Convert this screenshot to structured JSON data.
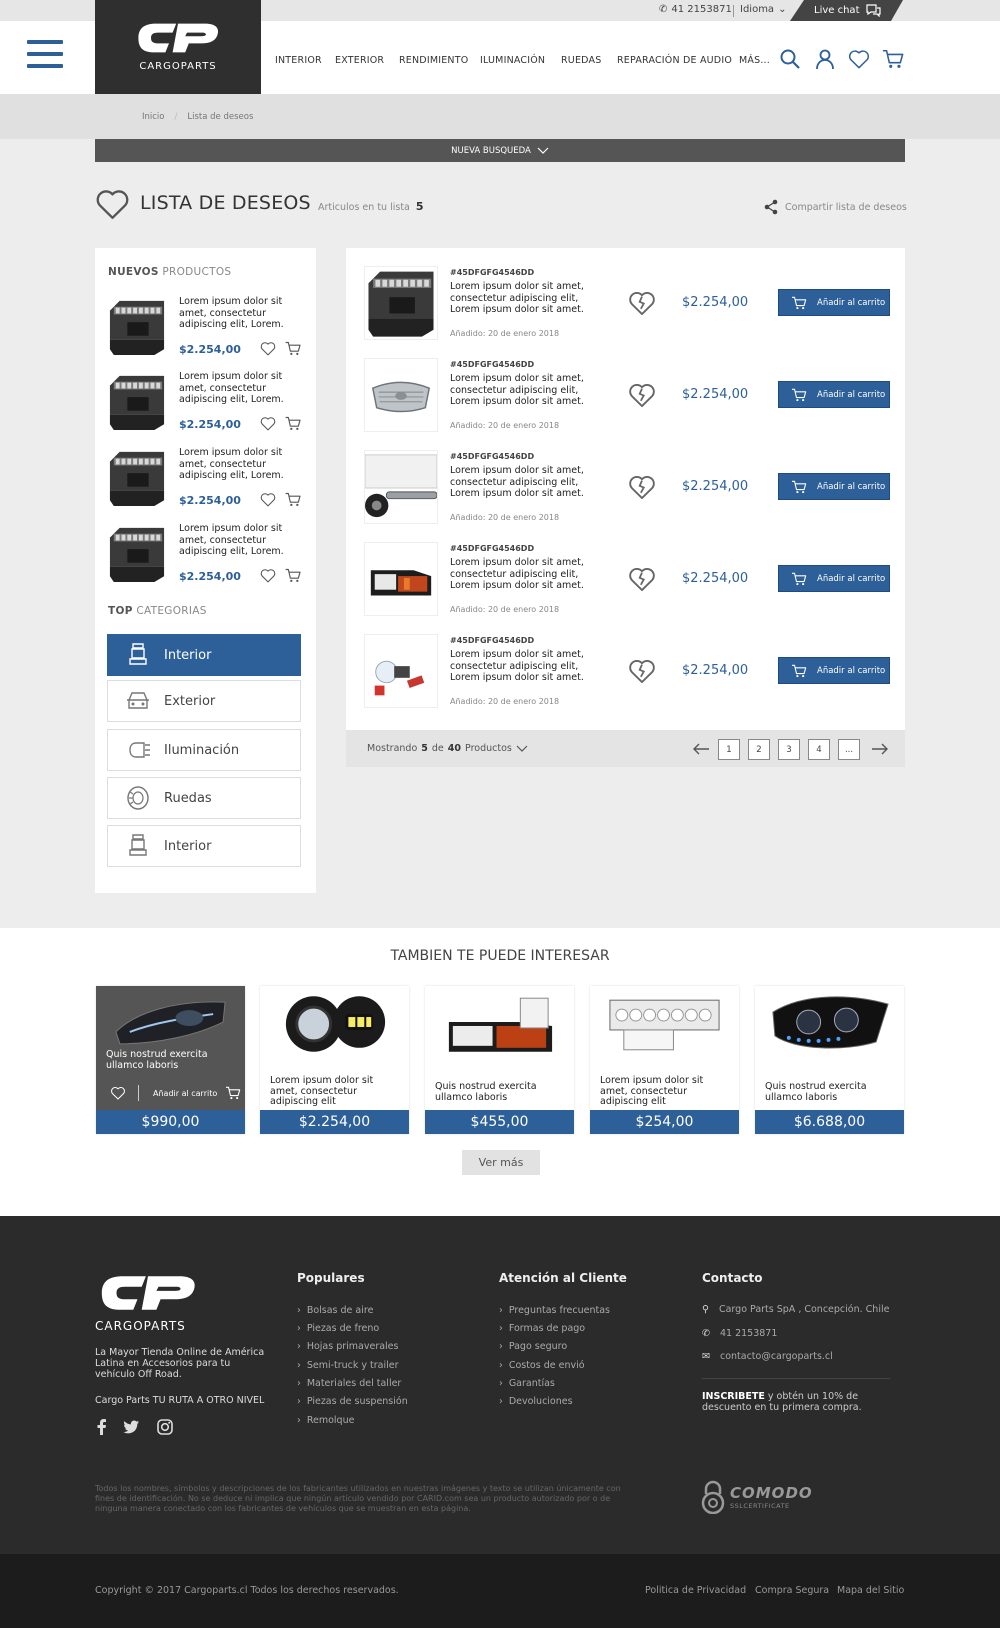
{
  "header": {
    "phone": "41 2153871",
    "language": "Idioma",
    "live_chat": "Live chat",
    "logo_word": "CARGOPARTS",
    "nav": [
      "INTERIOR",
      "EXTERIOR",
      "RENDIMIENTO",
      "ILUMINACIÓN",
      "RUEDAS",
      "REPARACIÓN DE AUDIO",
      "MÁS..."
    ],
    "icons": [
      "search-icon",
      "user-icon",
      "heart-icon",
      "cart-icon"
    ]
  },
  "breadcrumb": [
    "Inicio",
    "Lista de deseos"
  ],
  "new_search": "NUEVA BUSQUEDA",
  "page": {
    "title": "LISTA DE DESEOS",
    "count_label": "Articulos en tu lista",
    "count": "5",
    "share": "Compartir lista de deseos"
  },
  "sidebar": {
    "new_products_bold": "NUEVOS",
    "new_products_rest": " PRODUCTOS",
    "products": [
      {
        "text": "Lorem ipsum dolor sit amet, consectetur adipiscing elit, Lorem.",
        "price": "$2.254,00"
      },
      {
        "text": "Lorem ipsum dolor sit amet, consectetur adipiscing elit, Lorem.",
        "price": "$2.254,00"
      },
      {
        "text": "Lorem ipsum dolor sit amet, consectetur adipiscing elit, Lorem.",
        "price": "$2.254,00"
      },
      {
        "text": "Lorem ipsum dolor sit amet, consectetur adipiscing elit, Lorem.",
        "price": "$2.254,00"
      }
    ],
    "top_cat_bold": "TOP",
    "top_cat_rest": " CATEGORIAS",
    "categories": [
      {
        "label": "Interior",
        "icon": "seat-icon"
      },
      {
        "label": "Exterior",
        "icon": "car-front-icon"
      },
      {
        "label": "Iluminación",
        "icon": "headlight-icon"
      },
      {
        "label": "Ruedas",
        "icon": "tire-icon"
      },
      {
        "label": "Interior",
        "icon": "seat-icon"
      }
    ]
  },
  "wishlist": {
    "items": [
      {
        "sku": "#45DFGFG4546DD",
        "desc": "Lorem ipsum dolor sit amet, consectetur adipiscing elit, Lorem ipsum dolor sit amet.",
        "date": "Añadido: 20 de enero 2018",
        "price": "$2.254,00",
        "add_label": "Añadir al carrito"
      },
      {
        "sku": "#45DFGFG4546DD",
        "desc": "Lorem ipsum dolor sit amet, consectetur adipiscing elit, Lorem ipsum dolor sit amet.",
        "date": "Añadido: 20 de enero 2018",
        "price": "$2.254,00",
        "add_label": "Añadir al carrito"
      },
      {
        "sku": "#45DFGFG4546DD",
        "desc": "Lorem ipsum dolor sit amet, consectetur adipiscing elit, Lorem ipsum dolor sit amet.",
        "date": "Añadido: 20 de enero 2018",
        "price": "$2.254,00",
        "add_label": "Añadir al carrito"
      },
      {
        "sku": "#45DFGFG4546DD",
        "desc": "Lorem ipsum dolor sit amet, consectetur adipiscing elit, Lorem ipsum dolor sit amet.",
        "date": "Añadido: 20 de enero 2018",
        "price": "$2.254,00",
        "add_label": "Añadir al carrito"
      },
      {
        "sku": "#45DFGFG4546DD",
        "desc": "Lorem ipsum dolor sit amet, consectetur adipiscing elit, Lorem ipsum dolor sit amet.",
        "date": "Añadido: 20 de enero 2018",
        "price": "$2.254,00",
        "add_label": "Añadir al carrito"
      }
    ],
    "pager": {
      "showing_pre": "Mostrando",
      "showing_count": "5",
      "showing_mid": "de",
      "showing_total": "40",
      "showing_post": "Productos",
      "pages": [
        "1",
        "2",
        "3",
        "4",
        "..."
      ]
    }
  },
  "recommendations": {
    "title": "TAMBIEN TE PUEDE INTERESAR",
    "add_label": "Añadir al carrito",
    "items": [
      {
        "name": "Quis nostrud exercita ullamco laboris",
        "price": "$990,00"
      },
      {
        "name": "Lorem ipsum dolor sit amet, consectetur adipiscing elit",
        "price": "$2.254,00"
      },
      {
        "name": "Quis nostrud exercita ullamco laboris",
        "price": "$455,00"
      },
      {
        "name": "Lorem ipsum dolor sit amet, consectetur adipiscing elit",
        "price": "$254,00"
      },
      {
        "name": "Quis nostrud exercita ullamco laboris",
        "price": "$6.688,00"
      }
    ],
    "more": "Ver más"
  },
  "footer": {
    "logo_word": "CARGOPARTS",
    "tagline": "La Mayor Tienda Online de América Latina en Accesorios para tu vehículo Off Road.",
    "tagline2": "Cargo Parts TU RUTA A OTRO NIVEL",
    "populares_title": "Populares",
    "populares": [
      "Bolsas de aire",
      "Piezas de freno",
      "Hojas primaverales",
      "Semi-truck y trailer",
      "Materiales del taller",
      "Piezas de suspensión",
      "Remolque"
    ],
    "atencion_title": "Atención al Cliente",
    "atencion": [
      "Preguntas frecuentas",
      "Formas de pago",
      "Pago seguro",
      "Costos de envió",
      "Garantías",
      "Devoluciones"
    ],
    "contacto_title": "Contacto",
    "address": "Cargo Parts SpA , Concepción. Chile",
    "phone": "41 2153871",
    "email": "contacto@cargoparts.cl",
    "subscribe_bold": "INSCRIBETE",
    "subscribe_rest": " y obtén un 10% de descuento en tu primera compra.",
    "legal": "Todos los nombres, símbolos y descripciones de los fabricantes utilizados en nuestras imágenes y texto se utilizan únicamente con fines de identificación. No se deduce ni implica que ningún artículo vendido por CARID.com sea un producto autorizado por o de ninguna manera conectado con los fabricantes de vehículos que se muestran en esta página.",
    "comodo": "COMODO",
    "comodo_sub": "SSLCERTIFICATE",
    "copyright": "Copyright © 2017 Cargoparts.cl   Todos los derechos reservados.",
    "bottom_links": [
      "Politica de Privacidad",
      "Compra Segura",
      "Mapa del Sitio"
    ]
  },
  "colors": {
    "brand_blue": "#2d5f99",
    "dark": "#2f2f2f",
    "footer": "#2b2b2b"
  }
}
